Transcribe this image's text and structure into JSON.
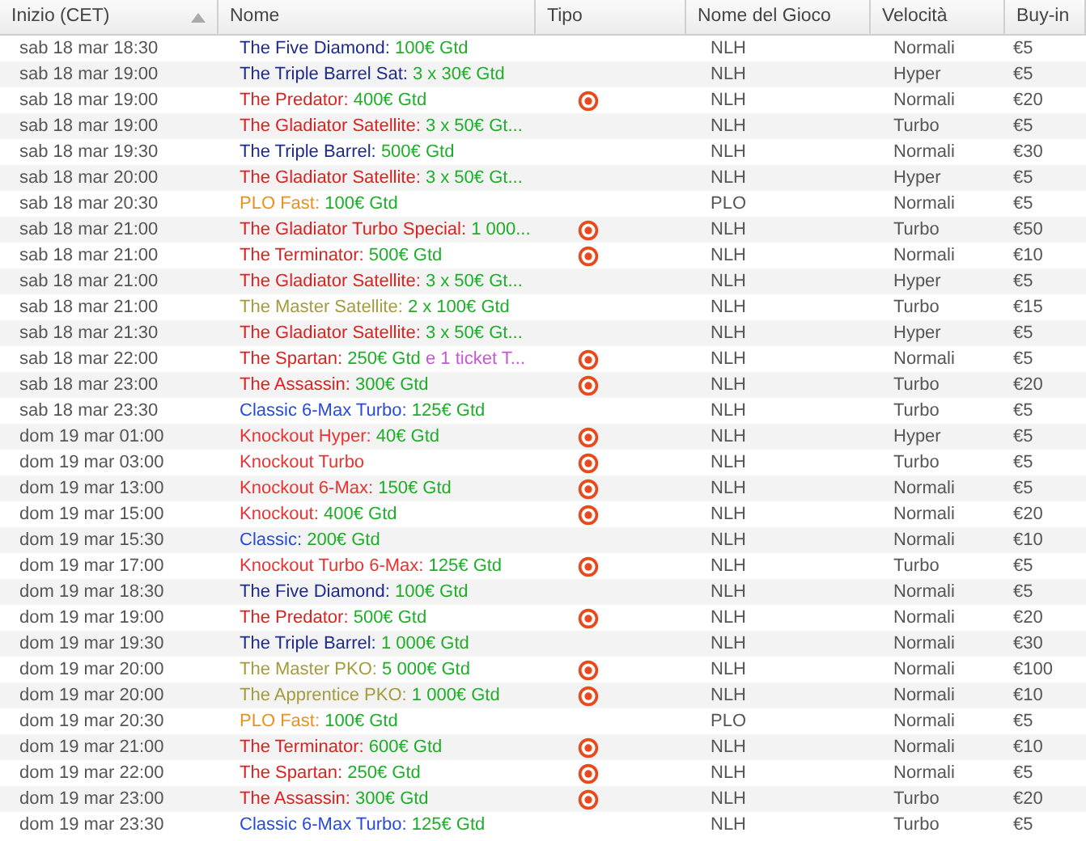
{
  "columns": [
    {
      "label": "Inizio (CET)",
      "sorted": true
    },
    {
      "label": "Nome",
      "sorted": false
    },
    {
      "label": "Tipo",
      "sorted": false
    },
    {
      "label": "Nome del Gioco",
      "sorted": false
    },
    {
      "label": "Velocità",
      "sorted": false
    },
    {
      "label": "Buy-in",
      "sorted": false
    }
  ],
  "rows": [
    {
      "start": "sab 18 mar 18:30",
      "name": [
        {
          "text": "The Five Diamond:",
          "color": "#1c2a8f"
        },
        {
          "text": "100€ Gtd",
          "color": "#1fae2a"
        }
      ],
      "bounty": false,
      "game": "NLH",
      "speed": "Normali",
      "buyin": "€5"
    },
    {
      "start": "sab 18 mar 19:00",
      "name": [
        {
          "text": "The Triple Barrel Sat:",
          "color": "#1c2a8f"
        },
        {
          "text": "3 x 30€ Gtd",
          "color": "#1fae2a"
        }
      ],
      "bounty": false,
      "game": "NLH",
      "speed": "Hyper",
      "buyin": "€5"
    },
    {
      "start": "sab 18 mar 19:00",
      "name": [
        {
          "text": "The Predator:",
          "color": "#dd2020"
        },
        {
          "text": "400€ Gtd",
          "color": "#1fae2a"
        }
      ],
      "bounty": true,
      "game": "NLH",
      "speed": "Normali",
      "buyin": "€20"
    },
    {
      "start": "sab 18 mar 19:00",
      "name": [
        {
          "text": "The Gladiator Satellite:",
          "color": "#dd2020"
        },
        {
          "text": "3 x 50€ Gt...",
          "color": "#1fae2a"
        }
      ],
      "bounty": false,
      "game": "NLH",
      "speed": "Turbo",
      "buyin": "€5"
    },
    {
      "start": "sab 18 mar 19:30",
      "name": [
        {
          "text": "The Triple Barrel:",
          "color": "#1c2a8f"
        },
        {
          "text": "500€ Gtd",
          "color": "#1fae2a"
        }
      ],
      "bounty": false,
      "game": "NLH",
      "speed": "Normali",
      "buyin": "€30"
    },
    {
      "start": "sab 18 mar 20:00",
      "name": [
        {
          "text": "The Gladiator Satellite:",
          "color": "#dd2020"
        },
        {
          "text": "3 x 50€ Gt...",
          "color": "#1fae2a"
        }
      ],
      "bounty": false,
      "game": "NLH",
      "speed": "Hyper",
      "buyin": "€5"
    },
    {
      "start": "sab 18 mar 20:30",
      "name": [
        {
          "text": "PLO Fast:",
          "color": "#e8921c"
        },
        {
          "text": "100€ Gtd",
          "color": "#1fae2a"
        }
      ],
      "bounty": false,
      "game": "PLO",
      "speed": "Normali",
      "buyin": "€5"
    },
    {
      "start": "sab 18 mar 21:00",
      "name": [
        {
          "text": "The Gladiator Turbo Special:",
          "color": "#dd2020"
        },
        {
          "text": "1 000...",
          "color": "#1fae2a"
        }
      ],
      "bounty": true,
      "game": "NLH",
      "speed": "Turbo",
      "buyin": "€50"
    },
    {
      "start": "sab 18 mar 21:00",
      "name": [
        {
          "text": "The Terminator:",
          "color": "#dd2020"
        },
        {
          "text": "500€ Gtd",
          "color": "#1fae2a"
        }
      ],
      "bounty": true,
      "game": "NLH",
      "speed": "Normali",
      "buyin": "€10"
    },
    {
      "start": "sab 18 mar 21:00",
      "name": [
        {
          "text": "The Gladiator Satellite:",
          "color": "#dd2020"
        },
        {
          "text": "3 x 50€ Gt...",
          "color": "#1fae2a"
        }
      ],
      "bounty": false,
      "game": "NLH",
      "speed": "Hyper",
      "buyin": "€5"
    },
    {
      "start": "sab 18 mar 21:00",
      "name": [
        {
          "text": "The Master Satellite:",
          "color": "#a39b3c"
        },
        {
          "text": "2 x 100€ Gtd",
          "color": "#1fae2a"
        }
      ],
      "bounty": false,
      "game": "NLH",
      "speed": "Turbo",
      "buyin": "€15"
    },
    {
      "start": "sab 18 mar 21:30",
      "name": [
        {
          "text": "The Gladiator Satellite:",
          "color": "#dd2020"
        },
        {
          "text": "3 x 50€ Gt...",
          "color": "#1fae2a"
        }
      ],
      "bounty": false,
      "game": "NLH",
      "speed": "Hyper",
      "buyin": "€5"
    },
    {
      "start": "sab 18 mar 22:00",
      "name": [
        {
          "text": "The Spartan:",
          "color": "#dd2020"
        },
        {
          "text": "250€ Gtd",
          "color": "#1fae2a"
        },
        {
          "text": "e 1 ticket T...",
          "color": "#c655d8"
        }
      ],
      "bounty": true,
      "game": "NLH",
      "speed": "Normali",
      "buyin": "€5"
    },
    {
      "start": "sab 18 mar 23:00",
      "name": [
        {
          "text": "The Assassin:",
          "color": "#dd2020"
        },
        {
          "text": "300€ Gtd",
          "color": "#1fae2a"
        }
      ],
      "bounty": true,
      "game": "NLH",
      "speed": "Turbo",
      "buyin": "€20"
    },
    {
      "start": "sab 18 mar 23:30",
      "name": [
        {
          "text": "Classic 6-Max Turbo:",
          "color": "#2848e0"
        },
        {
          "text": "125€ Gtd",
          "color": "#1fae2a"
        }
      ],
      "bounty": false,
      "game": "NLH",
      "speed": "Turbo",
      "buyin": "€5"
    },
    {
      "start": "dom 19 mar 01:00",
      "name": [
        {
          "text": "Knockout Hyper:",
          "color": "#ee3030"
        },
        {
          "text": "40€ Gtd",
          "color": "#1fae2a"
        }
      ],
      "bounty": true,
      "game": "NLH",
      "speed": "Hyper",
      "buyin": "€5"
    },
    {
      "start": "dom 19 mar 03:00",
      "name": [
        {
          "text": "Knockout Turbo",
          "color": "#ee3030"
        }
      ],
      "bounty": true,
      "game": "NLH",
      "speed": "Turbo",
      "buyin": "€5"
    },
    {
      "start": "dom 19 mar 13:00",
      "name": [
        {
          "text": "Knockout 6-Max:",
          "color": "#ee3030"
        },
        {
          "text": "150€ Gtd",
          "color": "#1fae2a"
        }
      ],
      "bounty": true,
      "game": "NLH",
      "speed": "Normali",
      "buyin": "€5"
    },
    {
      "start": "dom 19 mar 15:00",
      "name": [
        {
          "text": "Knockout:",
          "color": "#ee3030"
        },
        {
          "text": "400€ Gtd",
          "color": "#1fae2a"
        }
      ],
      "bounty": true,
      "game": "NLH",
      "speed": "Normali",
      "buyin": "€20"
    },
    {
      "start": "dom 19 mar 15:30",
      "name": [
        {
          "text": "Classic:",
          "color": "#2848e0"
        },
        {
          "text": "200€ Gtd",
          "color": "#1fae2a"
        }
      ],
      "bounty": false,
      "game": "NLH",
      "speed": "Normali",
      "buyin": "€10"
    },
    {
      "start": "dom 19 mar 17:00",
      "name": [
        {
          "text": "Knockout Turbo 6-Max:",
          "color": "#ee3030"
        },
        {
          "text": "125€ Gtd",
          "color": "#1fae2a"
        }
      ],
      "bounty": true,
      "game": "NLH",
      "speed": "Turbo",
      "buyin": "€5"
    },
    {
      "start": "dom 19 mar 18:30",
      "name": [
        {
          "text": "The Five Diamond:",
          "color": "#1c2a8f"
        },
        {
          "text": "100€ Gtd",
          "color": "#1fae2a"
        }
      ],
      "bounty": false,
      "game": "NLH",
      "speed": "Normali",
      "buyin": "€5"
    },
    {
      "start": "dom 19 mar 19:00",
      "name": [
        {
          "text": "The Predator:",
          "color": "#dd2020"
        },
        {
          "text": "500€ Gtd",
          "color": "#1fae2a"
        }
      ],
      "bounty": true,
      "game": "NLH",
      "speed": "Normali",
      "buyin": "€20"
    },
    {
      "start": "dom 19 mar 19:30",
      "name": [
        {
          "text": "The Triple Barrel:",
          "color": "#1c2a8f"
        },
        {
          "text": "1 000€ Gtd",
          "color": "#1fae2a"
        }
      ],
      "bounty": false,
      "game": "NLH",
      "speed": "Normali",
      "buyin": "€30"
    },
    {
      "start": "dom 19 mar 20:00",
      "name": [
        {
          "text": "The Master PKO:",
          "color": "#a39b3c"
        },
        {
          "text": "5 000€ Gtd",
          "color": "#1fae2a"
        }
      ],
      "bounty": true,
      "game": "NLH",
      "speed": "Normali",
      "buyin": "€100"
    },
    {
      "start": "dom 19 mar 20:00",
      "name": [
        {
          "text": "The Apprentice PKO:",
          "color": "#a39b3c"
        },
        {
          "text": "1 000€ Gtd",
          "color": "#1fae2a"
        }
      ],
      "bounty": true,
      "game": "NLH",
      "speed": "Normali",
      "buyin": "€10"
    },
    {
      "start": "dom 19 mar 20:30",
      "name": [
        {
          "text": "PLO Fast:",
          "color": "#e8921c"
        },
        {
          "text": "100€ Gtd",
          "color": "#1fae2a"
        }
      ],
      "bounty": false,
      "game": "PLO",
      "speed": "Normali",
      "buyin": "€5"
    },
    {
      "start": "dom 19 mar 21:00",
      "name": [
        {
          "text": "The Terminator:",
          "color": "#dd2020"
        },
        {
          "text": "600€ Gtd",
          "color": "#1fae2a"
        }
      ],
      "bounty": true,
      "game": "NLH",
      "speed": "Normali",
      "buyin": "€10"
    },
    {
      "start": "dom 19 mar 22:00",
      "name": [
        {
          "text": "The Spartan:",
          "color": "#dd2020"
        },
        {
          "text": "250€ Gtd",
          "color": "#1fae2a"
        }
      ],
      "bounty": true,
      "game": "NLH",
      "speed": "Normali",
      "buyin": "€5"
    },
    {
      "start": "dom 19 mar 23:00",
      "name": [
        {
          "text": "The Assassin:",
          "color": "#dd2020"
        },
        {
          "text": "300€ Gtd",
          "color": "#1fae2a"
        }
      ],
      "bounty": true,
      "game": "NLH",
      "speed": "Turbo",
      "buyin": "€20"
    },
    {
      "start": "dom 19 mar 23:30",
      "name": [
        {
          "text": "Classic 6-Max Turbo:",
          "color": "#2848e0"
        },
        {
          "text": "125€ Gtd",
          "color": "#1fae2a"
        }
      ],
      "bounty": false,
      "game": "NLH",
      "speed": "Turbo",
      "buyin": "€5"
    }
  ]
}
